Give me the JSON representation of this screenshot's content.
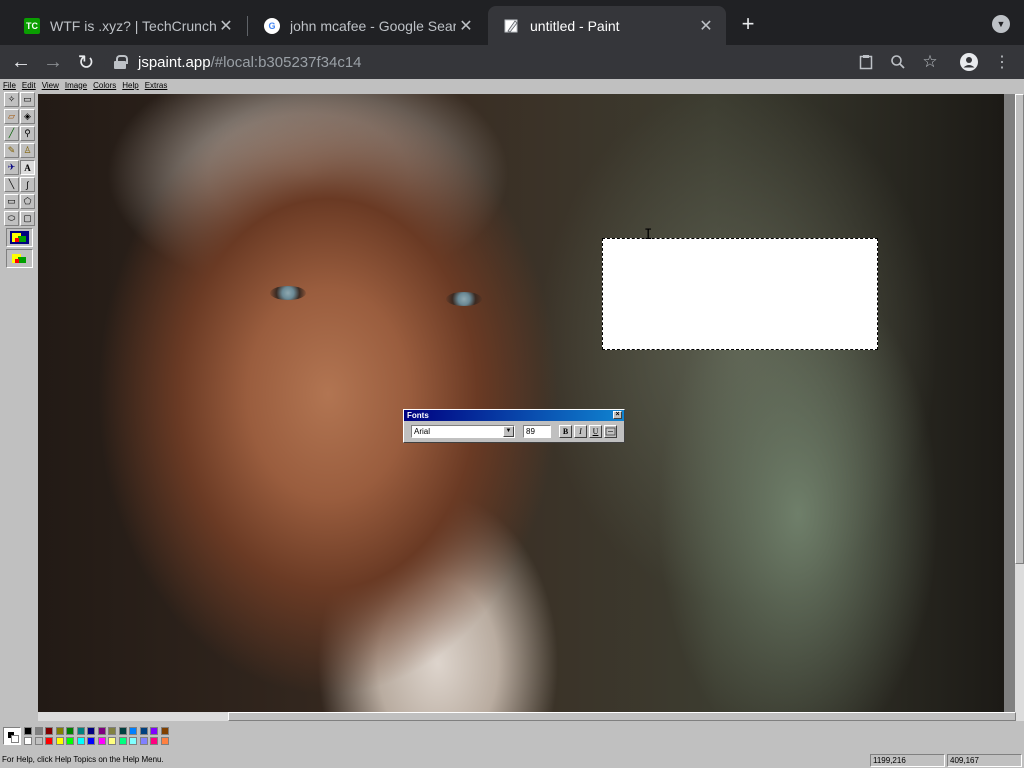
{
  "browser": {
    "tabs": [
      {
        "title": "WTF is .xyz? | TechCrunch",
        "favicon": "TC"
      },
      {
        "title": "john mcafee - Google Search",
        "favicon": "G"
      },
      {
        "title": "untitled - Paint",
        "favicon": "paint-icon"
      }
    ],
    "url_host": "jspaint.app",
    "url_path": "/#local:b305237f34c14"
  },
  "paint": {
    "menus": [
      "File",
      "Edit",
      "View",
      "Image",
      "Colors",
      "Help",
      "Extras"
    ],
    "fonts_window": {
      "title": "Fonts",
      "font_family": "Arial",
      "font_size": "89",
      "bold": "B",
      "italic": "I",
      "underline": "U"
    },
    "palette": [
      "#000000",
      "#808080",
      "#800000",
      "#808000",
      "#008000",
      "#008080",
      "#000080",
      "#800080",
      "#808040",
      "#004040",
      "#0080ff",
      "#004080",
      "#8000ff",
      "#804000",
      "#ffffff",
      "#c0c0c0",
      "#ff0000",
      "#ffff00",
      "#00ff00",
      "#00ffff",
      "#0000ff",
      "#ff00ff",
      "#ffff80",
      "#00ff80",
      "#80ffff",
      "#8080ff",
      "#ff0080",
      "#ff8040"
    ],
    "status": {
      "help": "For Help, click Help Topics on the Help Menu.",
      "position": "1199,216",
      "size": "409,167"
    }
  }
}
